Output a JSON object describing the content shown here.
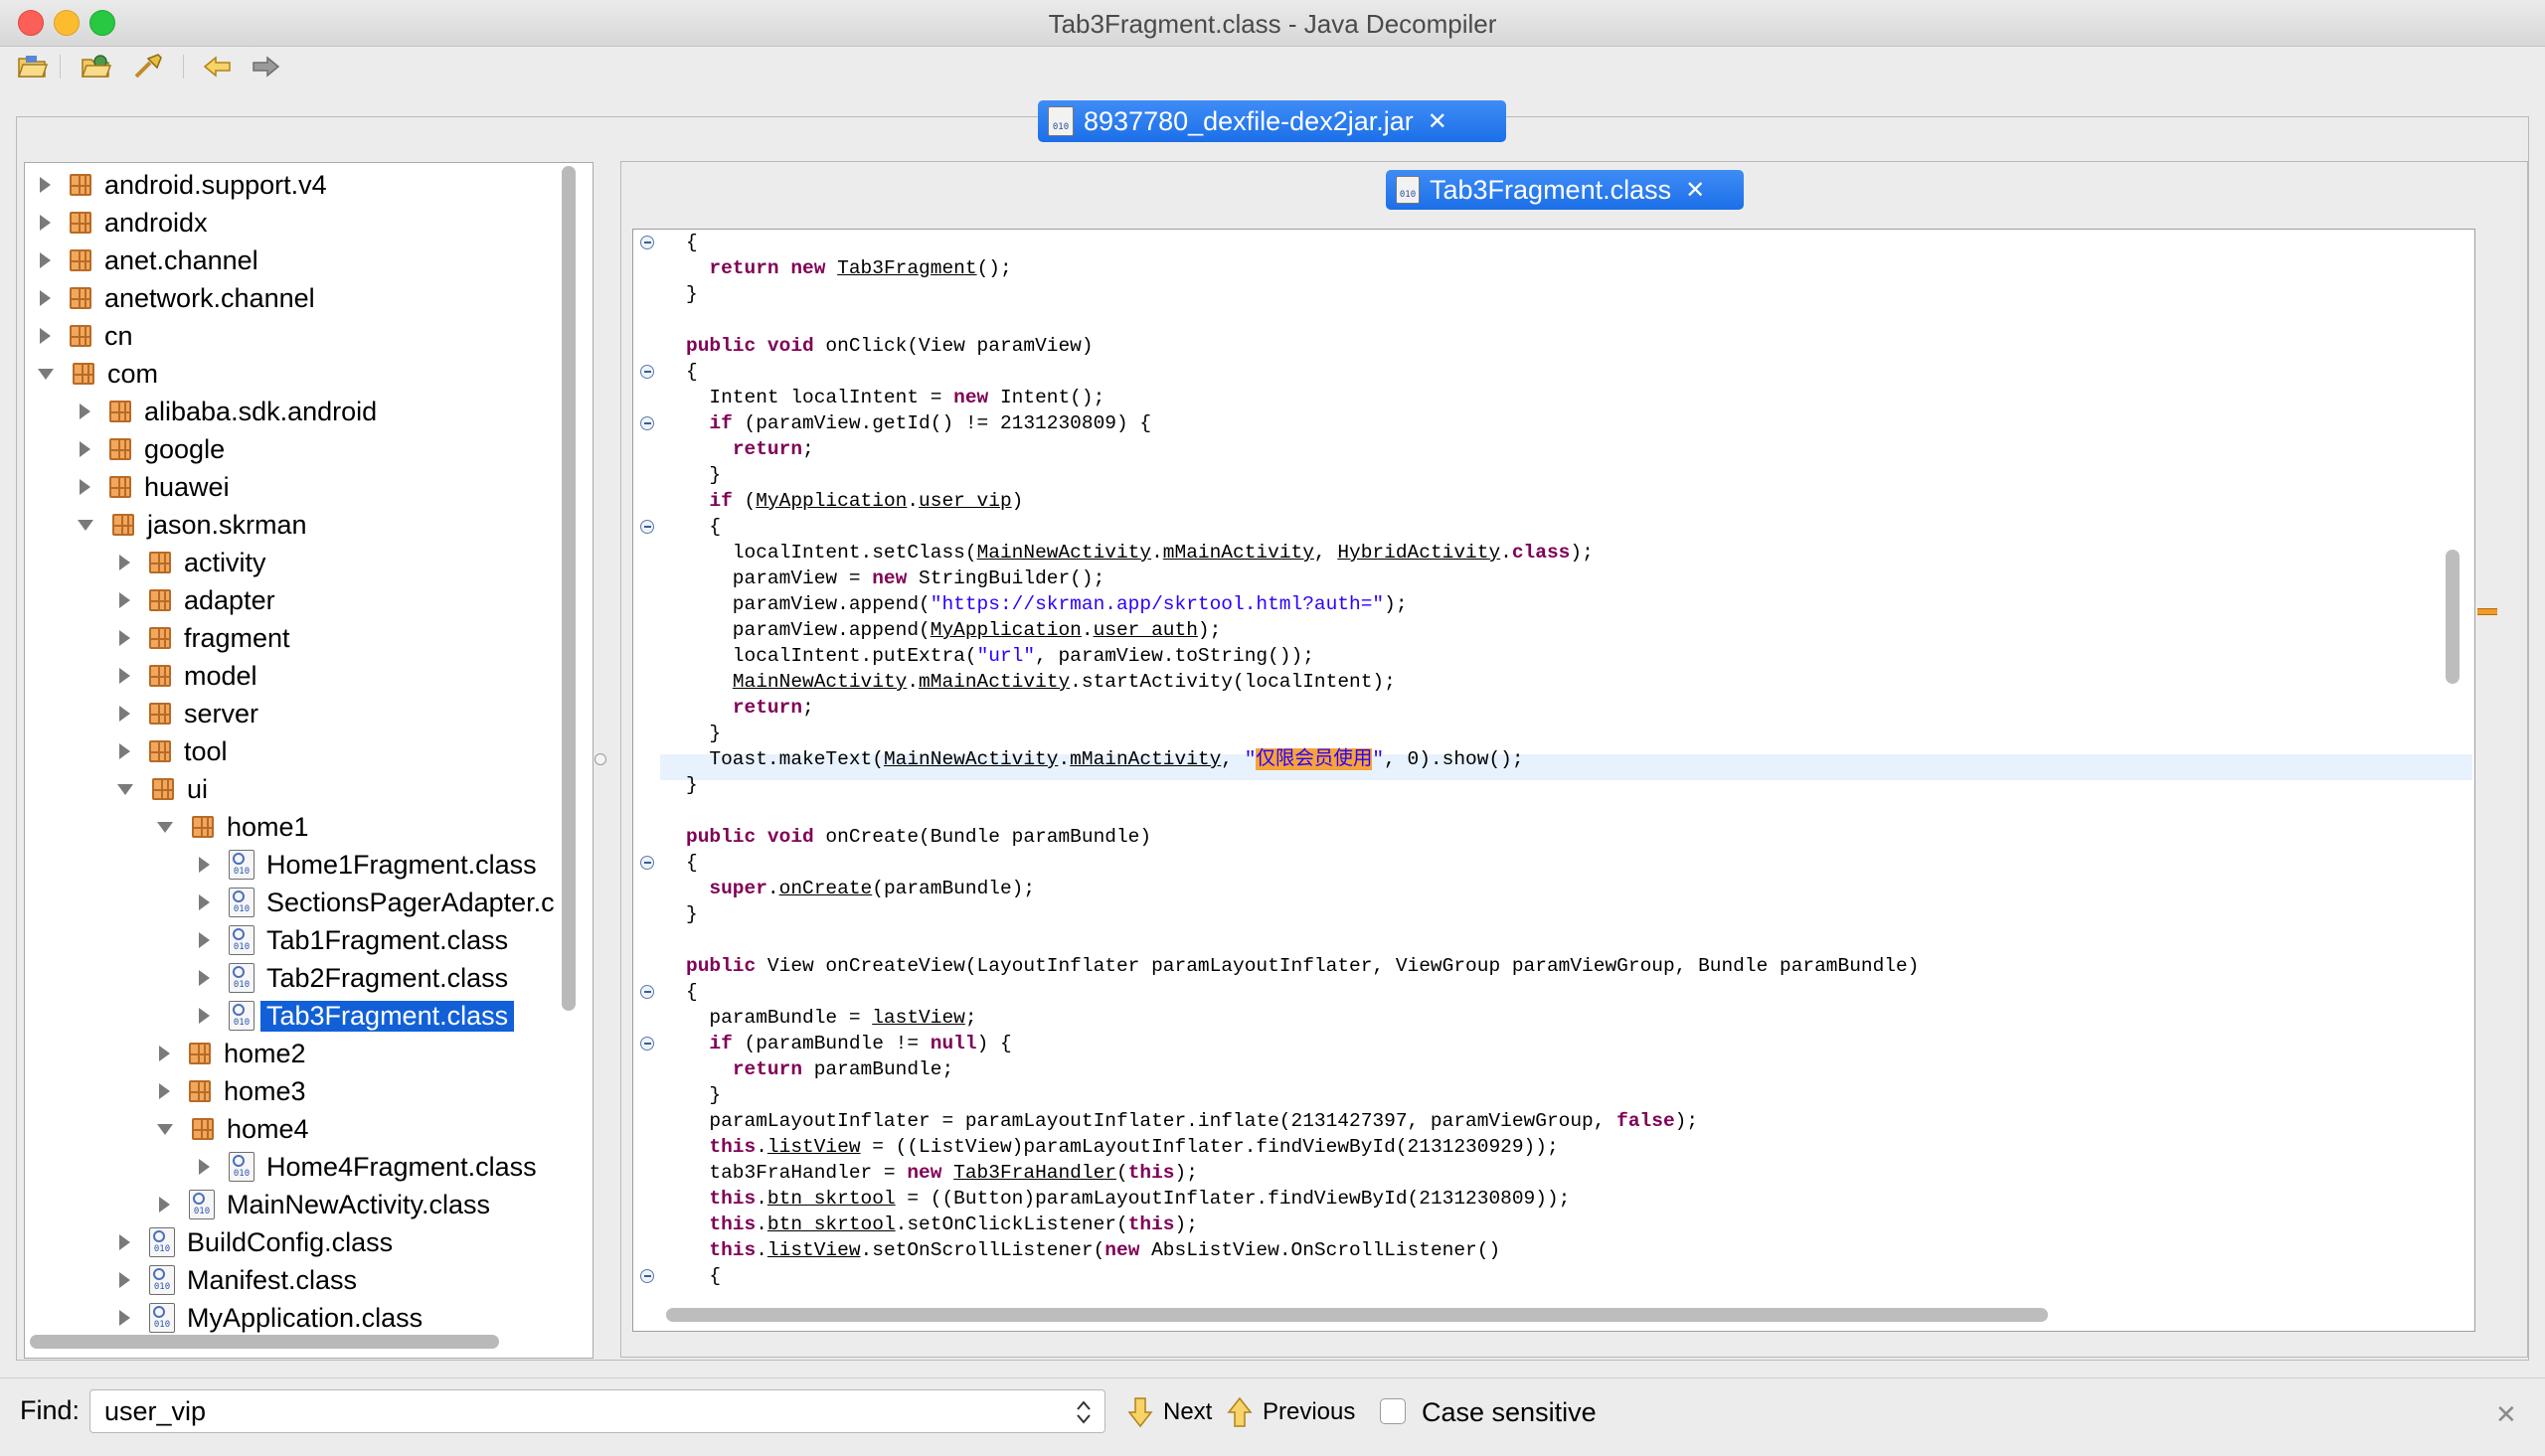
{
  "window": {
    "title": "Tab3Fragment.class - Java Decompiler",
    "traffic_lights": {
      "close": "#fc5f57",
      "minimize": "#fdbc2e",
      "zoom": "#28c840"
    }
  },
  "toolbar": {
    "buttons": [
      "open-file-icon",
      "open-folder-icon",
      "search-icon",
      "back-arrow-icon",
      "forward-arrow-icon"
    ]
  },
  "outer_tab": {
    "label": "8937780_dexfile-dex2jar.jar",
    "close": "✕"
  },
  "code_tab": {
    "label": "Tab3Fragment.class",
    "close": "✕"
  },
  "tree": {
    "nodes": [
      {
        "label": "android.support.v4",
        "depth": 0,
        "arrow": "right",
        "icon": "package"
      },
      {
        "label": "androidx",
        "depth": 0,
        "arrow": "right",
        "icon": "package"
      },
      {
        "label": "anet.channel",
        "depth": 0,
        "arrow": "right",
        "icon": "package"
      },
      {
        "label": "anetwork.channel",
        "depth": 0,
        "arrow": "right",
        "icon": "package"
      },
      {
        "label": "cn",
        "depth": 0,
        "arrow": "right",
        "icon": "package"
      },
      {
        "label": "com",
        "depth": 0,
        "arrow": "down",
        "icon": "package"
      },
      {
        "label": "alibaba.sdk.android",
        "depth": 1,
        "arrow": "right",
        "icon": "package"
      },
      {
        "label": "google",
        "depth": 1,
        "arrow": "right",
        "icon": "package"
      },
      {
        "label": "huawei",
        "depth": 1,
        "arrow": "right",
        "icon": "package"
      },
      {
        "label": "jason.skrman",
        "depth": 1,
        "arrow": "down",
        "icon": "package"
      },
      {
        "label": "activity",
        "depth": 2,
        "arrow": "right",
        "icon": "package"
      },
      {
        "label": "adapter",
        "depth": 2,
        "arrow": "right",
        "icon": "package"
      },
      {
        "label": "fragment",
        "depth": 2,
        "arrow": "right",
        "icon": "package"
      },
      {
        "label": "model",
        "depth": 2,
        "arrow": "right",
        "icon": "package"
      },
      {
        "label": "server",
        "depth": 2,
        "arrow": "right",
        "icon": "package"
      },
      {
        "label": "tool",
        "depth": 2,
        "arrow": "right",
        "icon": "package"
      },
      {
        "label": "ui",
        "depth": 2,
        "arrow": "down",
        "icon": "package"
      },
      {
        "label": "home1",
        "depth": 3,
        "arrow": "down",
        "icon": "package"
      },
      {
        "label": "Home1Fragment.class",
        "depth": 4,
        "arrow": "right",
        "icon": "class"
      },
      {
        "label": "SectionsPagerAdapter.c",
        "depth": 4,
        "arrow": "right",
        "icon": "class"
      },
      {
        "label": "Tab1Fragment.class",
        "depth": 4,
        "arrow": "right",
        "icon": "class"
      },
      {
        "label": "Tab2Fragment.class",
        "depth": 4,
        "arrow": "right",
        "icon": "class"
      },
      {
        "label": "Tab3Fragment.class",
        "depth": 4,
        "arrow": "right",
        "icon": "class",
        "selected": true
      },
      {
        "label": "home2",
        "depth": 3,
        "arrow": "right",
        "icon": "package"
      },
      {
        "label": "home3",
        "depth": 3,
        "arrow": "right",
        "icon": "package"
      },
      {
        "label": "home4",
        "depth": 3,
        "arrow": "down",
        "icon": "package"
      },
      {
        "label": "Home4Fragment.class",
        "depth": 4,
        "arrow": "right",
        "icon": "class"
      },
      {
        "label": "MainNewActivity.class",
        "depth": 3,
        "arrow": "right",
        "icon": "class"
      },
      {
        "label": "BuildConfig.class",
        "depth": 2,
        "arrow": "right",
        "icon": "class"
      },
      {
        "label": "Manifest.class",
        "depth": 2,
        "arrow": "right",
        "icon": "class"
      },
      {
        "label": "MyApplication.class",
        "depth": 2,
        "arrow": "right",
        "icon": "class"
      }
    ]
  },
  "code": {
    "lines": [
      {
        "fold": true,
        "tokens": [
          [
            "t",
            "{"
          ]
        ]
      },
      {
        "tokens": [
          [
            "t",
            "  "
          ],
          [
            "kw",
            "return"
          ],
          [
            "t",
            " "
          ],
          [
            "kw",
            "new"
          ],
          [
            "t",
            " "
          ],
          [
            "u",
            "Tab3Fragment"
          ],
          [
            "t",
            "();"
          ]
        ]
      },
      {
        "tokens": [
          [
            "t",
            "}"
          ]
        ]
      },
      {
        "tokens": []
      },
      {
        "tokens": [
          [
            "kw",
            "public"
          ],
          [
            "t",
            " "
          ],
          [
            "kw",
            "void"
          ],
          [
            "t",
            " onClick(View paramView)"
          ]
        ]
      },
      {
        "fold": true,
        "tokens": [
          [
            "t",
            "{"
          ]
        ]
      },
      {
        "tokens": [
          [
            "t",
            "  Intent localIntent = "
          ],
          [
            "kw",
            "new"
          ],
          [
            "t",
            " Intent();"
          ]
        ]
      },
      {
        "fold": true,
        "tokens": [
          [
            "t",
            "  "
          ],
          [
            "kw",
            "if"
          ],
          [
            "t",
            " (paramView.getId() != 2131230809) {"
          ]
        ]
      },
      {
        "tokens": [
          [
            "t",
            "    "
          ],
          [
            "kw",
            "return"
          ],
          [
            "t",
            ";"
          ]
        ]
      },
      {
        "tokens": [
          [
            "t",
            "  }"
          ]
        ]
      },
      {
        "tokens": [
          [
            "t",
            "  "
          ],
          [
            "kw",
            "if"
          ],
          [
            "t",
            " ("
          ],
          [
            "u",
            "MyApplication"
          ],
          [
            "t",
            "."
          ],
          [
            "u",
            "user_vip"
          ],
          [
            "t",
            ")"
          ]
        ]
      },
      {
        "fold": true,
        "tokens": [
          [
            "t",
            "  {"
          ]
        ]
      },
      {
        "tokens": [
          [
            "t",
            "    localIntent.setClass("
          ],
          [
            "u",
            "MainNewActivity"
          ],
          [
            "t",
            "."
          ],
          [
            "u",
            "mMainActivity"
          ],
          [
            "t",
            ", "
          ],
          [
            "u",
            "HybridActivity"
          ],
          [
            "t",
            "."
          ],
          [
            "kw",
            "class"
          ],
          [
            "t",
            ");"
          ]
        ]
      },
      {
        "tokens": [
          [
            "t",
            "    paramView = "
          ],
          [
            "kw",
            "new"
          ],
          [
            "t",
            " StringBuilder();"
          ]
        ]
      },
      {
        "tokens": [
          [
            "t",
            "    paramView.append("
          ],
          [
            "s",
            "\"https://skrman.app/skrtool.html?auth=\""
          ],
          [
            "t",
            ");"
          ]
        ]
      },
      {
        "tokens": [
          [
            "t",
            "    paramView.append("
          ],
          [
            "u",
            "MyApplication"
          ],
          [
            "t",
            "."
          ],
          [
            "u",
            "user_auth"
          ],
          [
            "t",
            ");"
          ]
        ]
      },
      {
        "tokens": [
          [
            "t",
            "    localIntent.putExtra("
          ],
          [
            "s",
            "\"url\""
          ],
          [
            "t",
            ", paramView.toString());"
          ]
        ]
      },
      {
        "tokens": [
          [
            "t",
            "    "
          ],
          [
            "u",
            "MainNewActivity"
          ],
          [
            "t",
            "."
          ],
          [
            "u",
            "mMainActivity"
          ],
          [
            "t",
            ".startActivity(localIntent);"
          ]
        ]
      },
      {
        "tokens": [
          [
            "t",
            "    "
          ],
          [
            "kw",
            "return"
          ],
          [
            "t",
            ";"
          ]
        ]
      },
      {
        "tokens": [
          [
            "t",
            "  }"
          ]
        ]
      },
      {
        "current": true,
        "tokens": [
          [
            "t",
            "  Toast.makeText("
          ],
          [
            "u",
            "MainNewActivity"
          ],
          [
            "t",
            "."
          ],
          [
            "u",
            "mMainActivity"
          ],
          [
            "t",
            ", "
          ],
          [
            "s",
            "\""
          ],
          [
            "h",
            "仅限会员使用"
          ],
          [
            "s",
            "\""
          ],
          [
            "t",
            ", 0).show();"
          ]
        ]
      },
      {
        "tokens": [
          [
            "t",
            "}"
          ]
        ]
      },
      {
        "tokens": []
      },
      {
        "tokens": [
          [
            "kw",
            "public"
          ],
          [
            "t",
            " "
          ],
          [
            "kw",
            "void"
          ],
          [
            "t",
            " onCreate(Bundle paramBundle)"
          ]
        ]
      },
      {
        "fold": true,
        "tokens": [
          [
            "t",
            "{"
          ]
        ]
      },
      {
        "tokens": [
          [
            "t",
            "  "
          ],
          [
            "kw",
            "super"
          ],
          [
            "t",
            "."
          ],
          [
            "u",
            "onCreate"
          ],
          [
            "t",
            "(paramBundle);"
          ]
        ]
      },
      {
        "tokens": [
          [
            "t",
            "}"
          ]
        ]
      },
      {
        "tokens": []
      },
      {
        "tokens": [
          [
            "kw",
            "public"
          ],
          [
            "t",
            " View onCreateView(LayoutInflater paramLayoutInflater, ViewGroup paramViewGroup, Bundle paramBundle)"
          ]
        ]
      },
      {
        "fold": true,
        "tokens": [
          [
            "t",
            "{"
          ]
        ]
      },
      {
        "tokens": [
          [
            "t",
            "  paramBundle = "
          ],
          [
            "u",
            "lastView"
          ],
          [
            "t",
            ";"
          ]
        ]
      },
      {
        "fold": true,
        "tokens": [
          [
            "t",
            "  "
          ],
          [
            "kw",
            "if"
          ],
          [
            "t",
            " (paramBundle != "
          ],
          [
            "kw",
            "null"
          ],
          [
            "t",
            ") {"
          ]
        ]
      },
      {
        "tokens": [
          [
            "t",
            "    "
          ],
          [
            "kw",
            "return"
          ],
          [
            "t",
            " paramBundle;"
          ]
        ]
      },
      {
        "tokens": [
          [
            "t",
            "  }"
          ]
        ]
      },
      {
        "tokens": [
          [
            "t",
            "  paramLayoutInflater = paramLayoutInflater.inflate(2131427397, paramViewGroup, "
          ],
          [
            "kw",
            "false"
          ],
          [
            "t",
            ");"
          ]
        ]
      },
      {
        "tokens": [
          [
            "t",
            "  "
          ],
          [
            "kw",
            "this"
          ],
          [
            "t",
            "."
          ],
          [
            "u",
            "listView"
          ],
          [
            "t",
            " = ((ListView)paramLayoutInflater.findViewById(2131230929));"
          ]
        ]
      },
      {
        "tokens": [
          [
            "t",
            "  tab3FraHandler = "
          ],
          [
            "kw",
            "new"
          ],
          [
            "t",
            " "
          ],
          [
            "u",
            "Tab3FraHandler"
          ],
          [
            "t",
            "("
          ],
          [
            "kw",
            "this"
          ],
          [
            "t",
            ");"
          ]
        ]
      },
      {
        "tokens": [
          [
            "t",
            "  "
          ],
          [
            "kw",
            "this"
          ],
          [
            "t",
            "."
          ],
          [
            "u",
            "btn_skrtool"
          ],
          [
            "t",
            " = ((Button)paramLayoutInflater.findViewById(2131230809));"
          ]
        ]
      },
      {
        "tokens": [
          [
            "t",
            "  "
          ],
          [
            "kw",
            "this"
          ],
          [
            "t",
            "."
          ],
          [
            "u",
            "btn_skrtool"
          ],
          [
            "t",
            ".setOnClickListener("
          ],
          [
            "kw",
            "this"
          ],
          [
            "t",
            ");"
          ]
        ]
      },
      {
        "tokens": [
          [
            "t",
            "  "
          ],
          [
            "kw",
            "this"
          ],
          [
            "t",
            "."
          ],
          [
            "u",
            "listView"
          ],
          [
            "t",
            ".setOnScrollListener("
          ],
          [
            "kw",
            "new"
          ],
          [
            "t",
            " AbsListView.OnScrollListener()"
          ]
        ]
      },
      {
        "fold": true,
        "tokens": [
          [
            "t",
            "  {"
          ]
        ]
      }
    ]
  },
  "findbar": {
    "label": "Find:",
    "value": "user_vip",
    "next_label": "Next",
    "previous_label": "Previous",
    "case_label": "Case sensitive",
    "case_checked": false,
    "close": "✕"
  }
}
